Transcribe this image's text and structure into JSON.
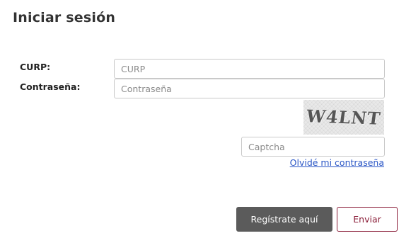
{
  "page": {
    "title": "Iniciar sesión"
  },
  "form": {
    "curp_label": "CURP:",
    "curp_placeholder": "CURP",
    "curp_value": "",
    "password_label": "Contraseña:",
    "password_placeholder": "Contraseña",
    "password_value": "",
    "captcha_text": "W4LNT",
    "captcha_placeholder": "Captcha",
    "captcha_value": "",
    "forgot_password_label": "Olvidé mi contraseña"
  },
  "actions": {
    "register_label": "Regístrate aquí",
    "submit_label": "Enviar"
  },
  "colors": {
    "register_button_bg": "#5b5b5b",
    "submit_button_accent": "#8a1d38",
    "link_color": "#2a56c6"
  }
}
